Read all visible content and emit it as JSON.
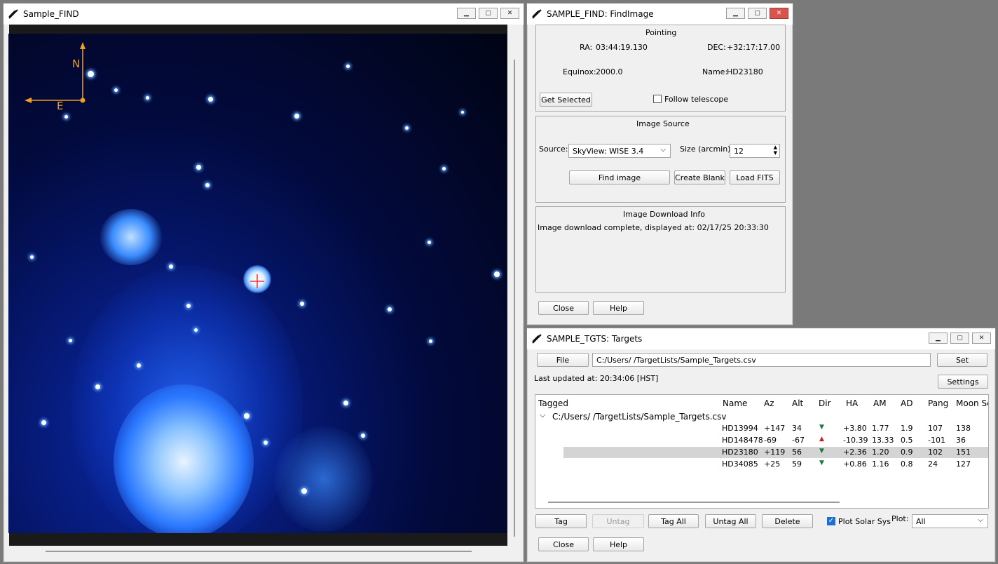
{
  "find_window": {
    "title": "Sample_FIND",
    "compass": {
      "north": "N",
      "east": "E"
    }
  },
  "findimage_window": {
    "title": "SAMPLE_FIND: FindImage",
    "pointing": {
      "header": "Pointing",
      "ra_label": "RA:",
      "ra_value": "03:44:19.130",
      "dec_label": "DEC:",
      "dec_value": "+32:17:17.00",
      "equinox_label": "Equinox:",
      "equinox_value": "2000.0",
      "name_label": "Name:",
      "name_value": "HD23180",
      "get_selected": "Get Selected",
      "follow_telescope": "Follow telescope",
      "follow_checked": false
    },
    "image_source": {
      "header": "Image Source",
      "source_label": "Source:",
      "source_value": "SkyView: WISE 3.4",
      "size_label": "Size (arcmin):",
      "size_value": "12",
      "find_image": "Find image",
      "create_blank": "Create Blank",
      "load_fits": "Load FITS"
    },
    "download_info": {
      "header": "Image Download Info",
      "message": "Image download complete, displayed at: 02/17/25 20:33:30"
    },
    "close": "Close",
    "help": "Help"
  },
  "targets_window": {
    "title": "SAMPLE_TGTS: Targets",
    "file_button": "File",
    "file_path": "C:/Users/      /TargetLists/Sample_Targets.csv",
    "set_button": "Set",
    "last_updated": "Last updated at: 20:34:06 [HST]",
    "settings_button": "Settings",
    "columns": [
      "Tagged",
      "Name",
      "Az",
      "Alt",
      "Dir",
      "HA",
      "AM",
      "AD",
      "Pang",
      "Moon Se"
    ],
    "group_label": "C:/Users/      /TargetLists/Sample_Targets.csv",
    "rows": [
      {
        "name": "HD13994",
        "az": "+147",
        "alt": "34",
        "dir": "down",
        "ha": "+3.80",
        "am": "1.77",
        "ad": "1.9",
        "pang": "107",
        "moon": "138",
        "selected": false
      },
      {
        "name": "HD148478",
        "az": "-69",
        "alt": "-67",
        "dir": "up",
        "ha": "-10.39",
        "am": "13.33",
        "ad": "0.5",
        "pang": "-101",
        "moon": "36",
        "selected": false
      },
      {
        "name": "HD23180",
        "az": "+119",
        "alt": "56",
        "dir": "down",
        "ha": "+2.36",
        "am": "1.20",
        "ad": "0.9",
        "pang": "102",
        "moon": "151",
        "selected": true
      },
      {
        "name": "HD34085",
        "az": "+25",
        "alt": "59",
        "dir": "down",
        "ha": "+0.86",
        "am": "1.16",
        "ad": "0.8",
        "pang": "24",
        "moon": "127",
        "selected": false
      }
    ],
    "tag": "Tag",
    "untag": "Untag",
    "tag_all": "Tag All",
    "untag_all": "Untag All",
    "delete": "Delete",
    "plot_solar_sys": "Plot Solar Sys",
    "plot_solar_checked": true,
    "plot_label": "Plot:",
    "plot_value": "All",
    "close": "Close",
    "help": "Help"
  },
  "colors": {
    "down_arrow": "#1e7a3c",
    "up_arrow": "#d11a1a",
    "compass": "#f0a020",
    "crosshair": "#ff3030",
    "selected_row": "#d4d4d4"
  }
}
